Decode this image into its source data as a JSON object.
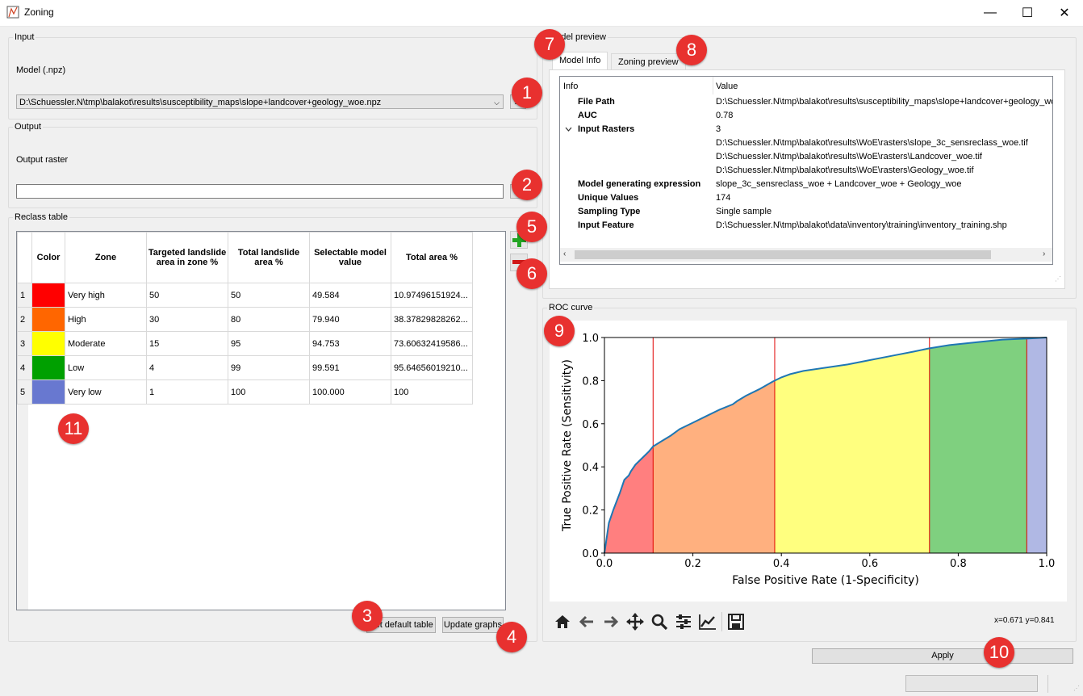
{
  "window": {
    "title": "Zoning",
    "minimize": "—",
    "maximize": "☐",
    "close": "✕"
  },
  "input": {
    "group_label": "Input",
    "model_label": "Model (.npz)",
    "model_path": "D:\\Schuessler.N\\tmp\\balakot\\results\\susceptibility_maps\\slope+landcover+geology_woe.npz",
    "browse_label": "..."
  },
  "output": {
    "group_label": "Output",
    "raster_label": "Output raster",
    "raster_value": "",
    "browse_label": "..."
  },
  "reclass": {
    "group_label": "Reclass table",
    "headers": {
      "color": "Color",
      "zone": "Zone",
      "targeted": "Targeted landslide area in zone %",
      "total_landslide": "Total landslide area %",
      "selectable": "Selectable model value",
      "total_area": "Total area %"
    },
    "rows": [
      {
        "n": "1",
        "color": "#ff0000",
        "zone": "Very high",
        "targeted": "50",
        "total_landslide": "50",
        "selectable": "49.584",
        "total_area": "10.97496151924..."
      },
      {
        "n": "2",
        "color": "#ff6600",
        "zone": "High",
        "targeted": "30",
        "total_landslide": "80",
        "selectable": "79.940",
        "total_area": "38.37829828262..."
      },
      {
        "n": "3",
        "color": "#ffff00",
        "zone": "Moderate",
        "targeted": "15",
        "total_landslide": "95",
        "selectable": "94.753",
        "total_area": "73.60632419586..."
      },
      {
        "n": "4",
        "color": "#00a000",
        "zone": "Low",
        "targeted": "4",
        "total_landslide": "99",
        "selectable": "99.591",
        "total_area": "95.64656019210..."
      },
      {
        "n": "5",
        "color": "#6878d0",
        "zone": "Very low",
        "targeted": "1",
        "total_landslide": "100",
        "selectable": "100.000",
        "total_area": "100"
      }
    ],
    "set_default_label": "Set default table",
    "update_graphs_label": "Update graphs"
  },
  "preview": {
    "group_label": "Model preview",
    "tabs": [
      "Model Info",
      "Zoning preview"
    ],
    "columns": [
      "Info",
      "Value"
    ],
    "rows": [
      {
        "key": "File Path",
        "value": "D:\\Schuessler.N\\tmp\\balakot\\results\\susceptibility_maps\\slope+landcover+geology_woe.npz"
      },
      {
        "key": "AUC",
        "value": "0.78"
      },
      {
        "key": "Input Rasters",
        "value": "3"
      },
      {
        "key": "",
        "value": "D:\\Schuessler.N\\tmp\\balakot\\results\\WoE\\rasters\\slope_3c_sensreclass_woe.tif"
      },
      {
        "key": "",
        "value": "D:\\Schuessler.N\\tmp\\balakot\\results\\WoE\\rasters\\Landcover_woe.tif"
      },
      {
        "key": "",
        "value": "D:\\Schuessler.N\\tmp\\balakot\\results\\WoE\\rasters\\Geology_woe.tif"
      },
      {
        "key": "Model generating expression",
        "value": "slope_3c_sensreclass_woe + Landcover_woe + Geology_woe"
      },
      {
        "key": "Unique Values",
        "value": "174"
      },
      {
        "key": "Sampling Type",
        "value": "Single sample"
      },
      {
        "key": "Input Feature",
        "value": "D:\\Schuessler.N\\tmp\\balakot\\data\\inventory\\training\\inventory_training.shp"
      }
    ]
  },
  "roc": {
    "group_label": "ROC curve",
    "coords": "x=0.671 y=0.841"
  },
  "chart_data": {
    "type": "area",
    "title": "",
    "xlabel": "False Positive Rate (1-Specificity)",
    "ylabel": "True Positive Rate (Sensitivity)",
    "xlim": [
      0.0,
      1.0
    ],
    "ylim": [
      0.0,
      1.0
    ],
    "xticks": [
      "0.0",
      "0.2",
      "0.4",
      "0.6",
      "0.8",
      "1.0"
    ],
    "yticks": [
      "0.0",
      "0.2",
      "0.4",
      "0.6",
      "0.8",
      "1.0"
    ],
    "grid": false,
    "x": [
      0.0,
      0.01,
      0.02,
      0.035,
      0.045,
      0.055,
      0.06,
      0.07,
      0.085,
      0.1,
      0.11,
      0.13,
      0.15,
      0.17,
      0.2,
      0.23,
      0.26,
      0.29,
      0.3,
      0.32,
      0.35,
      0.38,
      0.4,
      0.42,
      0.45,
      0.5,
      0.55,
      0.6,
      0.65,
      0.7,
      0.735,
      0.78,
      0.85,
      0.9,
      0.955,
      1.0
    ],
    "y": [
      0.0,
      0.14,
      0.2,
      0.28,
      0.34,
      0.36,
      0.38,
      0.41,
      0.44,
      0.47,
      0.495,
      0.52,
      0.545,
      0.575,
      0.605,
      0.635,
      0.665,
      0.69,
      0.705,
      0.73,
      0.76,
      0.795,
      0.815,
      0.83,
      0.845,
      0.86,
      0.875,
      0.895,
      0.915,
      0.935,
      0.95,
      0.965,
      0.98,
      0.99,
      0.995,
      1.0
    ],
    "line_color": "#1f77b4",
    "thresholds": [
      0.11,
      0.385,
      0.735,
      0.955
    ],
    "zones": [
      {
        "from": 0.0,
        "to": 0.11,
        "color": "#ff7f7f"
      },
      {
        "from": 0.11,
        "to": 0.385,
        "color": "#ffb07f"
      },
      {
        "from": 0.385,
        "to": 0.735,
        "color": "#ffff7f"
      },
      {
        "from": 0.735,
        "to": 0.955,
        "color": "#7fd07f"
      },
      {
        "from": 0.955,
        "to": 1.0,
        "color": "#b0b8e4"
      }
    ]
  },
  "apply_label": "Apply",
  "badges": [
    "1",
    "2",
    "3",
    "4",
    "5",
    "6",
    "7",
    "8",
    "9",
    "10",
    "11"
  ],
  "toolbar_icons": [
    "home-icon",
    "back-icon",
    "forward-icon",
    "pan-icon",
    "zoom-icon",
    "configure-subplots-icon",
    "edit-axis-icon",
    "save-icon"
  ]
}
